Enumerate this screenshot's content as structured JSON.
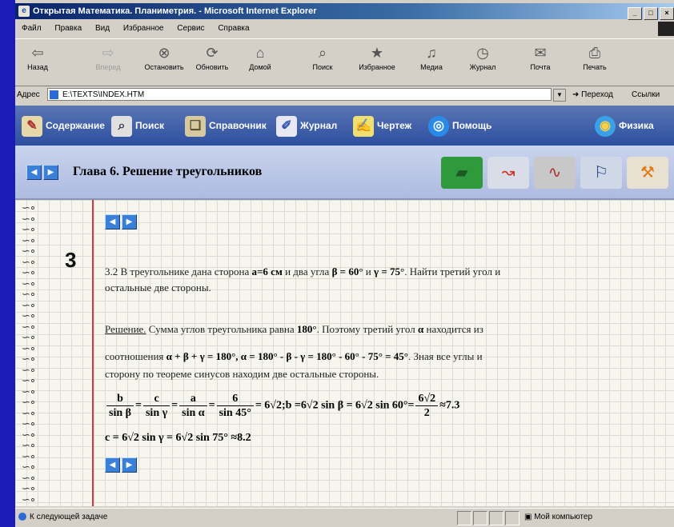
{
  "window": {
    "title": "Открытая Математика. Планиметрия. - Microsoft Internet Explorer",
    "controls": [
      "_",
      "□",
      "×"
    ]
  },
  "menu": {
    "items": [
      "Файл",
      "Правка",
      "Вид",
      "Избранное",
      "Сервис",
      "Справка"
    ]
  },
  "toolbar": {
    "back": "Назад",
    "forward": "Вперед",
    "stop": "Остановить",
    "refresh": "Обновить",
    "home": "Домой",
    "search": "Поиск",
    "favorites": "Избранное",
    "media": "Медиа",
    "history": "Журнал",
    "mail": "Почта",
    "print": "Печать"
  },
  "address": {
    "label": "Адрес",
    "value": "E:\\TEXTS\\INDEX.HTM",
    "go": "Переход",
    "links": "Ссылки"
  },
  "site_nav": {
    "items": [
      "Содержание",
      "Поиск",
      "Справочник",
      "Журнал",
      "Чертеж",
      "Помощь"
    ],
    "right": "Физика"
  },
  "chapter": {
    "title": "Глава 6. Решение треугольников"
  },
  "problem": {
    "number": "3",
    "statement_line1_a": "3.2 В треугольнике дана сторона ",
    "statement_line1_b": "a=6 см",
    "statement_line1_c": " и два угла ",
    "statement_line1_d": "β = 60°",
    "statement_line1_e": " и ",
    "statement_line1_f": "γ = 75°",
    "statement_line1_g": ". Найти третий угол и",
    "statement_line2": "остальные две стороны.",
    "solution_label": "Решение.",
    "solution_line1_a": " Сумма углов треугольника равна ",
    "solution_line1_b": "180°",
    "solution_line1_c": ". Поэтому третий угол ",
    "solution_line1_d": "α",
    "solution_line1_e": " находится из",
    "solution_line2_a": "соотношения ",
    "solution_line2_b": "α + β + γ = 180°, α = 180° - β - γ = 180° - 60° - 75° = 45°",
    "solution_line2_c": ". Зная все углы и",
    "solution_line3": "сторону по теореме синусов находим две остальные стороны.",
    "formula1": {
      "f1_num": "b",
      "f1_den": "sin β",
      "f2_num": "c",
      "f2_den": "sin γ",
      "f3_num": "a",
      "f3_den": "sin α",
      "f4_num": "6",
      "f4_den": "sin 45°",
      "mid": "= 6√2;b =6√2 sin β = 6√2 sin 60°=",
      "f5_num": "6√2",
      "f5_den": "2",
      "end": "≈7.3"
    },
    "formula2": "c = 6√2 sin γ = 6√2 sin 75° ≈8.2"
  },
  "status": {
    "message": "К следующей задаче",
    "zone": "Мой компьютер"
  }
}
